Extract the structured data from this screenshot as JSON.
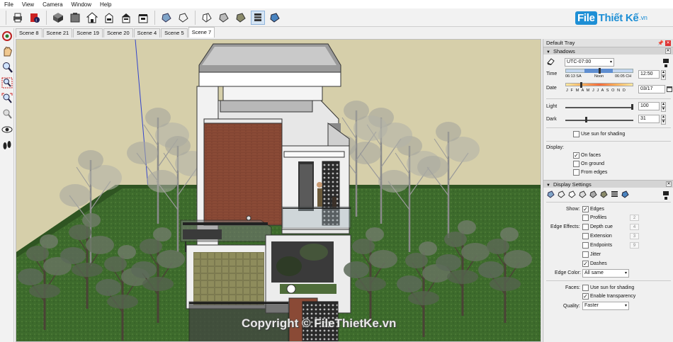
{
  "menu": [
    "File",
    "View",
    "Camera",
    "Window",
    "Help"
  ],
  "logo": {
    "box": "File",
    "text": "Thiết Kế",
    "suffix": ".vn"
  },
  "scenes": [
    "Scene 8",
    "Scene 21",
    "Scene 19",
    "Scene 20",
    "Scene 4",
    "Scene 5",
    "Scene 7"
  ],
  "active_scene": "Scene 7",
  "toolbar_icons": [
    "print-icon",
    "model-info-icon",
    "iso-view-icon",
    "top-view-icon",
    "front-view-icon",
    "right-view-icon",
    "back-view-icon",
    "left-view-icon",
    "xray-style-icon",
    "wireframe-style-icon",
    "hidden-line-style-icon",
    "shaded-style-icon",
    "shaded-textures-style-icon",
    "monochrome-style-icon"
  ],
  "left_tools": [
    "orbit-icon",
    "pan-icon",
    "zoom-icon",
    "zoom-window-icon",
    "zoom-extents-icon",
    "previous-view-icon",
    "look-around-icon",
    "walk-icon"
  ],
  "copyright": "Copyright © FileThietKe.vn",
  "tray": {
    "title": "Default Tray",
    "shadows": {
      "header": "Shadows",
      "timezone": "UTC-07:00",
      "time_label": "Time",
      "sunrise": "06:13 SA",
      "noon": "Noon",
      "sunset": "06:05 CH",
      "time_value": "12:50",
      "date_label": "Date",
      "months": "J F M A M J J A S O N D",
      "date_value": "03/17",
      "light_label": "Light",
      "light_value": "100",
      "dark_label": "Dark",
      "dark_value": "31",
      "use_sun_label": "Use sun for shading",
      "use_sun_checked": false,
      "display_label": "Display:",
      "on_faces_label": "On faces",
      "on_faces_checked": true,
      "on_ground_label": "On ground",
      "on_ground_checked": false,
      "from_edges_label": "From edges",
      "from_edges_checked": false
    },
    "display_settings": {
      "header": "Display Settings",
      "show_label": "Show:",
      "edges_label": "Edges",
      "edges_checked": true,
      "profiles_label": "Profiles",
      "profiles_checked": false,
      "profiles_value": "2",
      "edge_effects_label": "Edge Effects:",
      "depth_cue_label": "Depth cue",
      "depth_cue_checked": false,
      "depth_cue_value": "4",
      "extension_label": "Extension",
      "extension_checked": false,
      "extension_value": "3",
      "endpoints_label": "Endpoints",
      "endpoints_checked": false,
      "endpoints_value": "9",
      "jitter_label": "Jitter",
      "jitter_checked": false,
      "dashes_label": "Dashes",
      "dashes_checked": true,
      "edge_color_label": "Edge Color:",
      "edge_color_value": "All same",
      "faces_label": "Faces:",
      "faces_use_sun_label": "Use sun for shading",
      "faces_use_sun_checked": false,
      "transparency_label": "Enable transparency",
      "transparency_checked": true,
      "quality_label": "Quality:",
      "quality_value": "Faster"
    }
  },
  "colors": {
    "sky": "#d6cfaa",
    "grass": "#3f6f2e",
    "brick": "#8a4a36",
    "accent": "#1e8fd5"
  }
}
